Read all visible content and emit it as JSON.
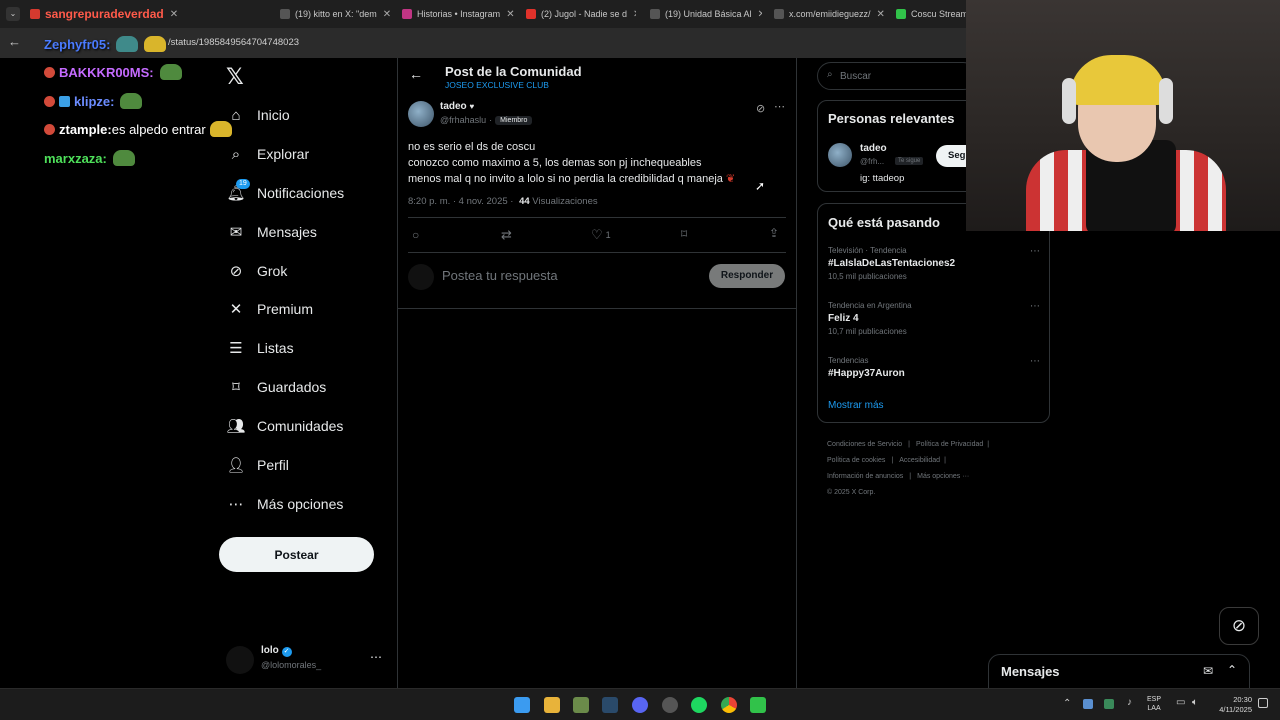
{
  "browser": {
    "tabs": [
      {
        "label": "sangrepuradeverdad",
        "color": "#d63a2f"
      },
      {
        "label": "(19) kitto en X: \"dem",
        "color": "#888"
      },
      {
        "label": "Historias • Instagram",
        "color": "#c13584"
      },
      {
        "label": "(2) Jugol - Nadie se d",
        "color": "#e0322b"
      },
      {
        "label": "(19) Unidad Básica Al",
        "color": "#888"
      },
      {
        "label": "x.com/emiidieguezz/",
        "color": "#888"
      },
      {
        "label": "Coscu Stream -",
        "color": "#31c24a"
      }
    ],
    "url": "/status/1985849564704748023"
  },
  "chat": [
    {
      "user": "Zephyfr05:",
      "color": "#4a7bff",
      "text": ""
    },
    {
      "user": "BAKKKR00MS:",
      "color": "#c56bff",
      "text": ""
    },
    {
      "user": "klipze:",
      "color": "#6b8cff",
      "text": ""
    },
    {
      "user": "ztample:",
      "color": "#ffffff",
      "text": " es alpedo entrar"
    },
    {
      "user": "marxzaza:",
      "color": "#4ee05a",
      "text": ""
    }
  ],
  "nav": {
    "items": [
      {
        "label": "Inicio",
        "icon": "home-icon"
      },
      {
        "label": "Explorar",
        "icon": "search-icon"
      },
      {
        "label": "Notificaciones",
        "icon": "bell-icon",
        "badge": "19"
      },
      {
        "label": "Mensajes",
        "icon": "mail-icon"
      },
      {
        "label": "Grok",
        "icon": "grok-icon"
      },
      {
        "label": "Premium",
        "icon": "x-icon"
      },
      {
        "label": "Listas",
        "icon": "list-icon"
      },
      {
        "label": "Guardados",
        "icon": "bookmark-icon"
      },
      {
        "label": "Comunidades",
        "icon": "communities-icon"
      },
      {
        "label": "Perfil",
        "icon": "person-icon"
      },
      {
        "label": "Más opciones",
        "icon": "more-icon"
      }
    ],
    "post_button": "Postear",
    "account": {
      "name": "lolo",
      "handle": "@lolomorales_"
    }
  },
  "post": {
    "header_title": "Post de la Comunidad",
    "community": "JOSEO EXCLUSIVE CLUB",
    "author_name": "tadeo",
    "author_handle": "@frhahaslu",
    "dot": "·",
    "member_badge": "Miembro",
    "lines": [
      "no es serio el ds de coscu",
      "conozco como maximo a 5, los demas son pj inchequeables",
      "menos mal q no invito a lolo si no perdia la credibilidad q maneja"
    ],
    "time": "8:20 p. m. · 4 nov. 2025 ·",
    "views_count": "44",
    "views_label": "Visualizaciones",
    "likes": "1",
    "reply_placeholder": "Postea tu respuesta",
    "reply_button": "Responder"
  },
  "right": {
    "search_placeholder": "Buscar",
    "relevant_title": "Personas relevantes",
    "relevant_user": {
      "name": "tadeo",
      "handle": "@frh...",
      "follows_you": "Te sigue",
      "bio": "ig: ttadeop",
      "follow_button": "Seg"
    },
    "trends_title": "Qué está pasando",
    "trends": [
      {
        "context": "Televisión · Tendencia",
        "name": "#LaIslaDeLasTentaciones2",
        "count": "10,5 mil publicaciones"
      },
      {
        "context": "Tendencia en Argentina",
        "name": "Feliz 4",
        "count": "10,7 mil publicaciones"
      },
      {
        "context": "Tendencias",
        "name": "#Happy37Auron",
        "count": ""
      }
    ],
    "show_more": "Mostrar más",
    "footer": [
      "Condiciones de Servicio",
      "Política de Privacidad",
      "Política de cookies",
      "Accesibilidad",
      "Información de anuncios",
      "Más opciones ···",
      "© 2025 X Corp."
    ]
  },
  "messages_dock": {
    "label": "Mensajes"
  },
  "taskbar": {
    "lang": "ESP",
    "lang_sub": "LAA",
    "time": "20:30",
    "date": "4/11/2025"
  },
  "colors": {
    "accent": "#1d9bf0",
    "background": "#000000",
    "border": "#2f3336",
    "muted": "#71767b"
  }
}
